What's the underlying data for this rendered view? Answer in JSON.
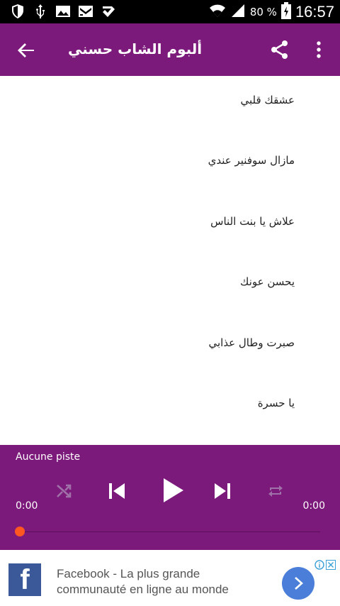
{
  "statusbar": {
    "battery_percent": "80 %",
    "time": "16:57",
    "icons": [
      "shield-icon",
      "usb-icon",
      "image-icon",
      "mail-icon",
      "check-icon",
      "wifi-icon",
      "signal-icon",
      "battery-charging-icon"
    ]
  },
  "appbar": {
    "title": "ألبوم الشاب حسني",
    "color": "#7b1a7b"
  },
  "songs": [
    "عشقك قلبي",
    "مازال سوفنير عندي",
    "علاش يا بنت الناس",
    "يحسن عونك",
    "صبرت وطال عذابي",
    "يا حسرة"
  ],
  "player": {
    "track_label": "Aucune piste",
    "elapsed": "0:00",
    "duration": "0:00",
    "progress": 0,
    "accent": "#ff5722"
  },
  "ad": {
    "advertiser_logo": "f",
    "line1": "Facebook - La plus grande",
    "line2": "communauté en ligne au monde"
  }
}
